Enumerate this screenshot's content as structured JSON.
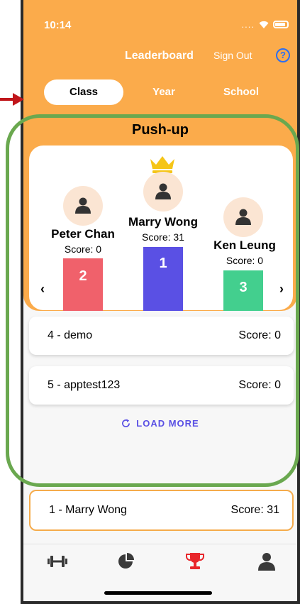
{
  "status_bar": {
    "time": "10:14",
    "signal": "...."
  },
  "header": {
    "title": "Leaderboard",
    "sign_out": "Sign Out",
    "help": "?"
  },
  "tabs": [
    {
      "label": "Class",
      "active": true
    },
    {
      "label": "Year",
      "active": false
    },
    {
      "label": "School",
      "active": false
    }
  ],
  "event": {
    "title": "Push-up"
  },
  "podium": [
    {
      "rank": "1",
      "name": "Marry Wong",
      "score": "Score: 31",
      "color": "#5a50e4"
    },
    {
      "rank": "2",
      "name": "Peter Chan",
      "score": "Score: 0",
      "color": "#f0616b"
    },
    {
      "rank": "3",
      "name": "Ken Leung",
      "score": "Score: 0",
      "color": "#43cf8e"
    }
  ],
  "nav_arrows": {
    "prev": "‹",
    "next": "›"
  },
  "list": [
    {
      "label": "4 - demo",
      "score": "Score: 0"
    },
    {
      "label": "5 - apptest123",
      "score": "Score: 0"
    }
  ],
  "load_more": "LOAD MORE",
  "my_rank": {
    "label": "1 - Marry Wong",
    "score": "Score: 31"
  },
  "bottom_tabs": [
    {
      "icon": "dumbbell-icon",
      "active": false
    },
    {
      "icon": "pie-chart-icon",
      "active": false
    },
    {
      "icon": "trophy-icon",
      "active": true
    },
    {
      "icon": "user-icon",
      "active": false
    }
  ],
  "colors": {
    "header": "#fbab4b",
    "accent": "#5a50e4",
    "active_tab_icon": "#e8262b",
    "highlight_outline": "#6aa84f"
  }
}
